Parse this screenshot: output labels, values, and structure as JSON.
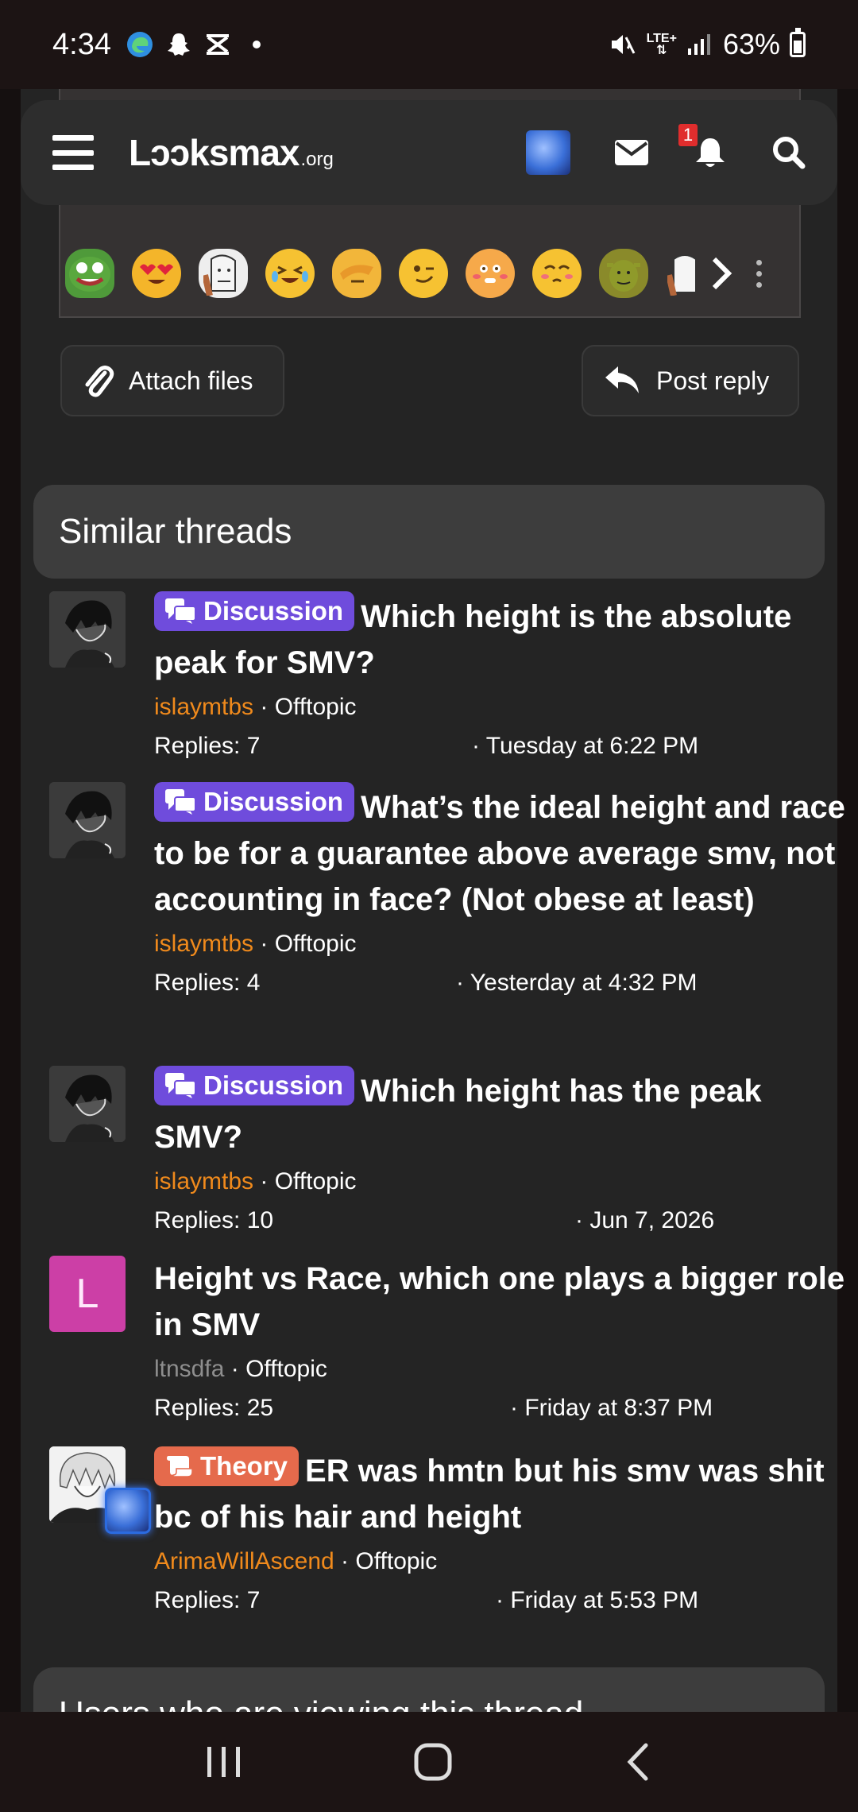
{
  "status_bar": {
    "time": "4:34",
    "network": "LTE+",
    "battery": "63%",
    "battery_level": 0.63
  },
  "header": {
    "logo_main": "Lͻͻksmax",
    "logo_suffix": ".org",
    "notification_count": "1",
    "icons": [
      "menu-icon",
      "mail-icon",
      "bell-icon",
      "search-icon"
    ]
  },
  "editor": {
    "emojis": [
      "pepe",
      "heart-eyes",
      "wojak",
      "laughing-tears",
      "facepalm",
      "wink",
      "blushing",
      "pleading",
      "shrek",
      "wojak-2"
    ]
  },
  "actions": {
    "attach_label": "Attach files",
    "reply_label": "Post reply"
  },
  "similar": {
    "heading": "Similar threads",
    "threads": [
      {
        "prefix": "Discussion",
        "title": "Which height is the absolute peak for SMV?",
        "author": "islaymtbs",
        "forum": "Offtopic",
        "replies": "Replies: 7",
        "date": "Tuesday at 6:22 PM"
      },
      {
        "prefix": "Discussion",
        "title": "What’s the ideal height and race to be for a guarantee above average smv, not accounting in face? (Not obese at least)",
        "author": "islaymtbs",
        "forum": "Offtopic",
        "replies": "Replies: 4",
        "date": "Yesterday at 4:32 PM"
      },
      {
        "prefix": "Discussion",
        "title": "Which height has the peak SMV?",
        "author": "islaymtbs",
        "forum": "Offtopic",
        "replies": "Replies: 10",
        "date": "Jun 7, 2026"
      },
      {
        "prefix": "",
        "title": "Height vs Race, which one plays a bigger role in SMV",
        "avatar_letter": "L",
        "author": "ltnsdfa",
        "forum": "Offtopic",
        "replies": "Replies: 25",
        "date": "Friday at 8:37 PM"
      },
      {
        "prefix": "Theory",
        "title": "ER was hmtn but his smv was shit bc of his hair and height",
        "author": "ArimaWillAscend",
        "forum": "Offtopic",
        "replies": "Replies: 7",
        "date": "Friday at 5:53 PM"
      }
    ]
  },
  "footer": {
    "heading": "Users who are viewing this thread"
  },
  "colors": {
    "discussion": "#6f4cdc",
    "theory": "#e56a4c",
    "author": "#f08a1c",
    "letter_avatar": "#cc3fa6"
  }
}
